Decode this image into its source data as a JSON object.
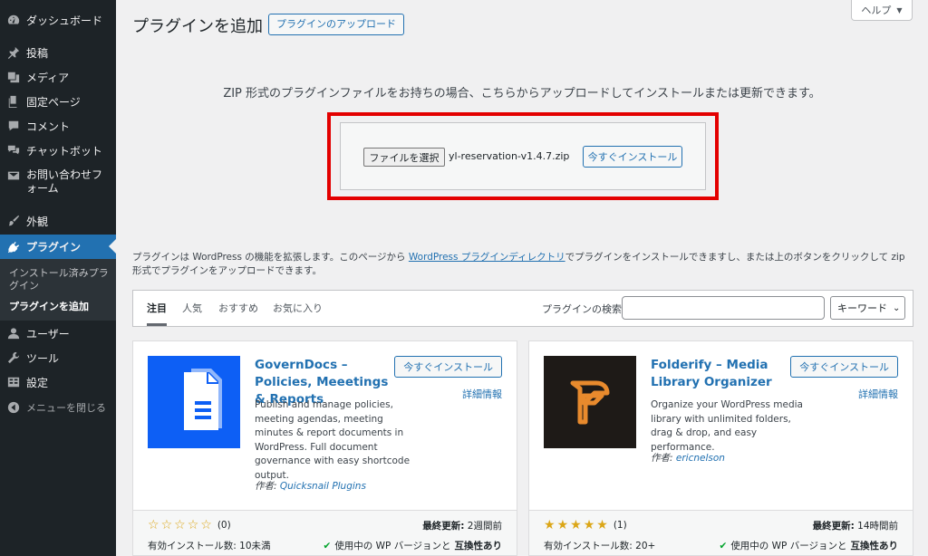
{
  "sidebar": {
    "items": [
      {
        "label": "ダッシュボード",
        "icon": "dashboard-icon"
      },
      {
        "label": "投稿",
        "icon": "pin-icon"
      },
      {
        "label": "メディア",
        "icon": "media-icon"
      },
      {
        "label": "固定ページ",
        "icon": "page-icon"
      },
      {
        "label": "コメント",
        "icon": "comment-icon"
      },
      {
        "label": "チャットボット",
        "icon": "chat-icon"
      },
      {
        "label": "お問い合わせフォーム",
        "icon": "mail-icon"
      },
      {
        "label": "外観",
        "icon": "appearance-icon"
      },
      {
        "label": "プラグイン",
        "icon": "plugin-icon"
      },
      {
        "label": "ユーザー",
        "icon": "user-icon"
      },
      {
        "label": "ツール",
        "icon": "tools-icon"
      },
      {
        "label": "設定",
        "icon": "settings-icon"
      },
      {
        "label": "メニューを閉じる",
        "icon": "collapse-icon"
      }
    ],
    "submenu": [
      {
        "label": "インストール済みプラグイン"
      },
      {
        "label": "プラグインを追加"
      }
    ],
    "active_color": "#2271b1"
  },
  "header": {
    "title": "プラグインを追加",
    "upload_button": "プラグインのアップロード",
    "help": "ヘルプ"
  },
  "upload": {
    "description": "ZIP 形式のプラグインファイルをお持ちの場合、こちらからアップロードしてインストールまたは更新できます。",
    "choose_file": "ファイルを選択",
    "file_name": "yl-reservation-v1.4.7.zip",
    "install_now": "今すぐインストール",
    "highlight_color": "#e30000"
  },
  "intro": {
    "text_before": "プラグインは WordPress の機能を拡張します。このページから ",
    "link": "WordPress プラグインディレクトリ",
    "text_after": "でプラグインをインストールできますし、または上のボタンをクリックして zip 形式でプラグインをアップロードできます。"
  },
  "filter": {
    "tabs": [
      "注目",
      "人気",
      "おすすめ",
      "お気に入り"
    ],
    "search_label": "プラグインの検索",
    "search_value": "",
    "search_type": "キーワード"
  },
  "cards": [
    {
      "name": "GovernDocs – Policies, Meeetings & Reports",
      "install": "今すぐインストール",
      "more": "詳細情報",
      "description": "Publish and manage policies, meeting agendas, meeting minutes & report documents in WordPress. Full document governance with easy shortcode output.",
      "author_prefix": "作者: ",
      "author": "Quicksnail Plugins",
      "rating_stars": 0,
      "rating_count": "(0)",
      "installs": "有効インストール数: 10未満",
      "updated_label": "最終更新:",
      "updated": " 2週間前",
      "compat_text": "使用中の WP バージョンと",
      "compat_bold": "互換性あり",
      "icon": "document-icon",
      "icon_bg": "#0d5ff5"
    },
    {
      "name": "Folderify – Media Library Organizer",
      "install": "今すぐインストール",
      "more": "詳細情報",
      "description": "Organize your WordPress media library with unlimited folders, drag & drop, and easy performance.",
      "author_prefix": "作者: ",
      "author": "ericnelson",
      "rating_stars": 5,
      "rating_count": "(1)",
      "installs": "有効インストール数: 20+",
      "updated_label": "最終更新:",
      "updated": " 14時間前",
      "compat_text": "使用中の WP バージョンと",
      "compat_bold": "互換性あり",
      "icon": "folderify-logo-icon",
      "icon_bg": "#1e1a17"
    }
  ]
}
